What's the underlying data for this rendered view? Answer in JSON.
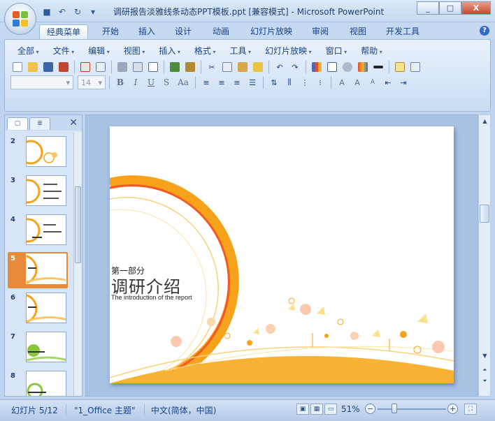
{
  "window": {
    "title": "调研报告淡雅线条动态PPT模板.ppt [兼容模式] - Microsoft PowerPoint",
    "min": "_",
    "max": "□",
    "close": "X"
  },
  "tabs": [
    "经典菜单",
    "开始",
    "插入",
    "设计",
    "动画",
    "幻灯片放映",
    "审阅",
    "视图",
    "开发工具"
  ],
  "help": "?",
  "menu": [
    "全部",
    "文件",
    "编辑",
    "视图",
    "插入",
    "格式",
    "工具",
    "幻灯片放映",
    "窗口",
    "帮助"
  ],
  "font": {
    "name": "",
    "size": "14"
  },
  "format_buttons": [
    "B",
    "I",
    "U",
    "S",
    "Aa"
  ],
  "thumbs_pane": {
    "slides": [
      {
        "num": "2"
      },
      {
        "num": "3"
      },
      {
        "num": "4"
      },
      {
        "num": "5",
        "selected": true
      },
      {
        "num": "6"
      },
      {
        "num": "7"
      },
      {
        "num": "8"
      }
    ]
  },
  "slide": {
    "subtitle": "第一部分",
    "title": "调研介绍",
    "english": "The introduction of the report"
  },
  "status": {
    "slide_info": "幻灯片 5/12",
    "theme": "\"1_Office 主题\"",
    "language": "中文(简体，中国)",
    "zoom": "51%",
    "zoom_minus": "−",
    "zoom_plus": "+"
  },
  "colors": {
    "accent_orange": "#f7a21b",
    "selected_thumb": "#e98a3a",
    "ribbon_blue": "#c5d9f1"
  }
}
